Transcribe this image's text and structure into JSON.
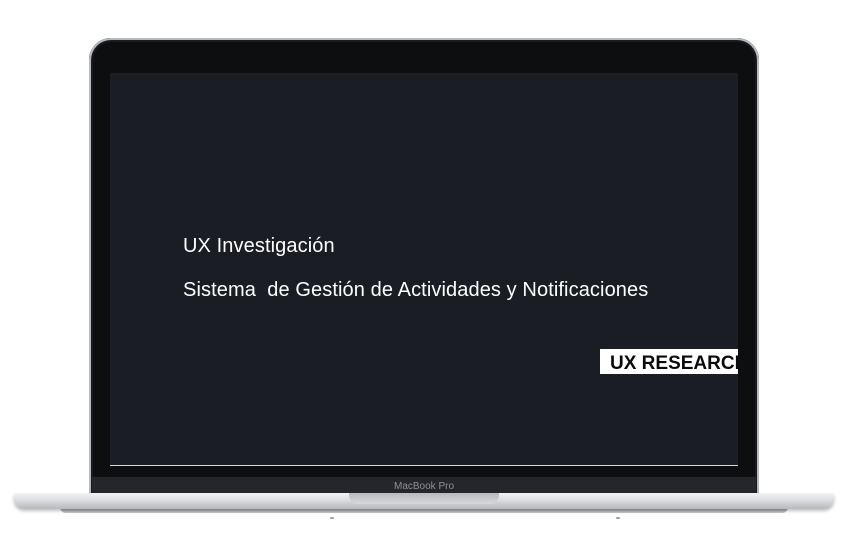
{
  "device": {
    "chin_label": "MacBook Pro"
  },
  "screen": {
    "title_line_1": "UX Investigación",
    "title_line_2": "Sistema  de Gestión de Actividades y Notificaciones",
    "badge": "UX RESEARCH"
  },
  "colors": {
    "screen_background": "#1a1d24",
    "text": "#ffffff",
    "badge_background": "#ffffff",
    "badge_text": "#0b0b0b"
  }
}
